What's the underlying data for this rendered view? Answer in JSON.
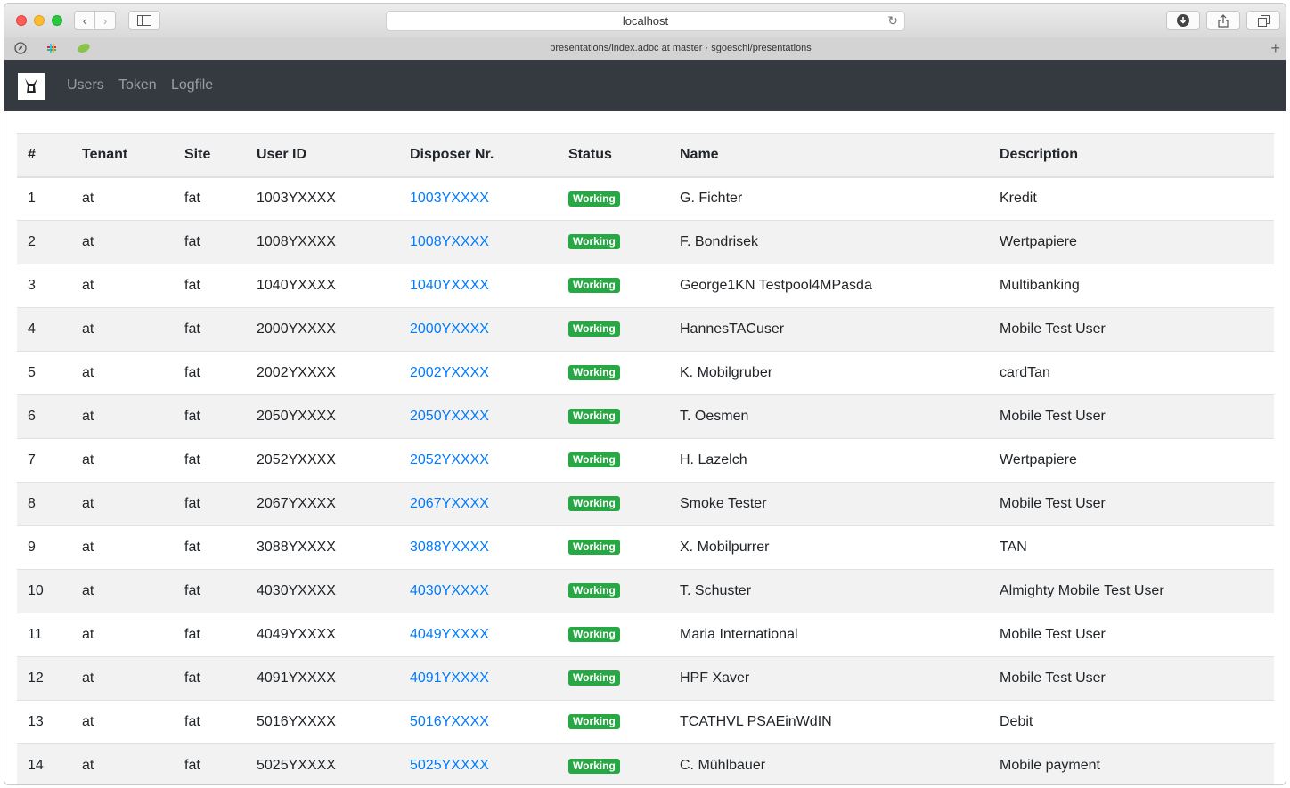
{
  "browser": {
    "url": "localhost",
    "tab_title": "presentations/index.adoc at master · sgoeschl/presentations"
  },
  "nav": {
    "logo_icon": "app-logo",
    "links": [
      "Users",
      "Token",
      "Logfile"
    ]
  },
  "table": {
    "headers": [
      "#",
      "Tenant",
      "Site",
      "User ID",
      "Disposer Nr.",
      "Status",
      "Name",
      "Description"
    ],
    "rows": [
      {
        "num": "1",
        "tenant": "at",
        "site": "fat",
        "user_id": "1003YXXXX",
        "disposer": "1003YXXXX",
        "status": "Working",
        "name": "G. Fichter",
        "description": "Kredit"
      },
      {
        "num": "2",
        "tenant": "at",
        "site": "fat",
        "user_id": "1008YXXXX",
        "disposer": "1008YXXXX",
        "status": "Working",
        "name": "F. Bondrisek",
        "description": "Wertpapiere"
      },
      {
        "num": "3",
        "tenant": "at",
        "site": "fat",
        "user_id": "1040YXXXX",
        "disposer": "1040YXXXX",
        "status": "Working",
        "name": "George1KN Testpool4MPasda",
        "description": "Multibanking"
      },
      {
        "num": "4",
        "tenant": "at",
        "site": "fat",
        "user_id": "2000YXXXX",
        "disposer": "2000YXXXX",
        "status": "Working",
        "name": "HannesTACuser",
        "description": "Mobile Test User"
      },
      {
        "num": "5",
        "tenant": "at",
        "site": "fat",
        "user_id": "2002YXXXX",
        "disposer": "2002YXXXX",
        "status": "Working",
        "name": "K. Mobilgruber",
        "description": "cardTan"
      },
      {
        "num": "6",
        "tenant": "at",
        "site": "fat",
        "user_id": "2050YXXXX",
        "disposer": "2050YXXXX",
        "status": "Working",
        "name": "T. Oesmen",
        "description": "Mobile Test User"
      },
      {
        "num": "7",
        "tenant": "at",
        "site": "fat",
        "user_id": "2052YXXXX",
        "disposer": "2052YXXXX",
        "status": "Working",
        "name": "H. Lazelch",
        "description": "Wertpapiere"
      },
      {
        "num": "8",
        "tenant": "at",
        "site": "fat",
        "user_id": "2067YXXXX",
        "disposer": "2067YXXXX",
        "status": "Working",
        "name": "Smoke Tester",
        "description": "Mobile Test User"
      },
      {
        "num": "9",
        "tenant": "at",
        "site": "fat",
        "user_id": "3088YXXXX",
        "disposer": "3088YXXXX",
        "status": "Working",
        "name": "X. Mobilpurrer",
        "description": "TAN"
      },
      {
        "num": "10",
        "tenant": "at",
        "site": "fat",
        "user_id": "4030YXXXX",
        "disposer": "4030YXXXX",
        "status": "Working",
        "name": "T. Schuster",
        "description": "Almighty Mobile Test User"
      },
      {
        "num": "11",
        "tenant": "at",
        "site": "fat",
        "user_id": "4049YXXXX",
        "disposer": "4049YXXXX",
        "status": "Working",
        "name": "Maria International",
        "description": "Mobile Test User"
      },
      {
        "num": "12",
        "tenant": "at",
        "site": "fat",
        "user_id": "4091YXXXX",
        "disposer": "4091YXXXX",
        "status": "Working",
        "name": "HPF Xaver",
        "description": "Mobile Test User"
      },
      {
        "num": "13",
        "tenant": "at",
        "site": "fat",
        "user_id": "5016YXXXX",
        "disposer": "5016YXXXX",
        "status": "Working",
        "name": "TCATHVL PSAEinWdIN",
        "description": "Debit"
      },
      {
        "num": "14",
        "tenant": "at",
        "site": "fat",
        "user_id": "5025YXXXX",
        "disposer": "5025YXXXX",
        "status": "Working",
        "name": "C. Mühlbauer",
        "description": "Mobile payment"
      }
    ]
  },
  "colors": {
    "navbar": "#343a40",
    "link": "#007bff",
    "status_working": "#28a745"
  }
}
